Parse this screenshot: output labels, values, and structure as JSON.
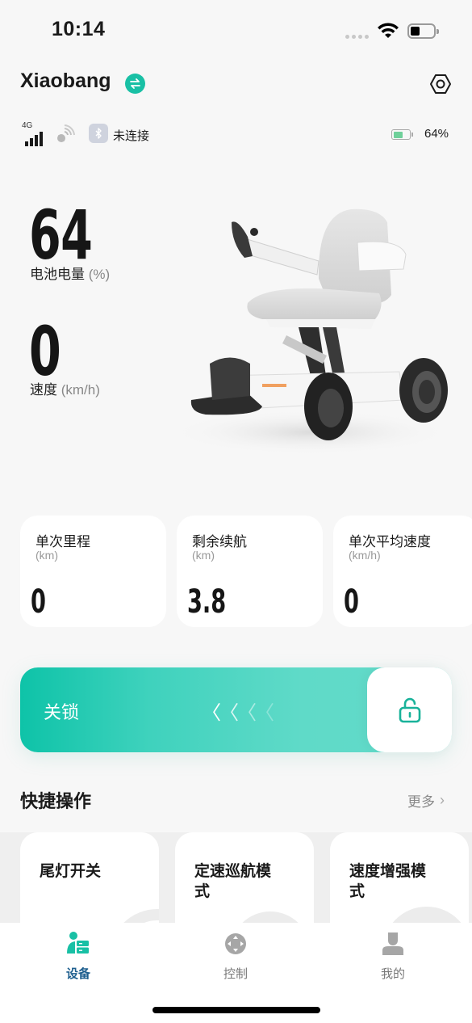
{
  "status_bar": {
    "time": "10:14",
    "icons": [
      "signal-dots-icon",
      "wifi-icon",
      "battery-icon"
    ]
  },
  "header": {
    "title": "Xiaobang",
    "switch_icon": "swap-arrows-icon",
    "settings_icon": "hex-settings-icon"
  },
  "connection": {
    "network_label": "4G",
    "network_icon": "cellular-signal-icon",
    "gps_icon": "satellite-icon",
    "bluetooth_icon": "bluetooth-icon",
    "bluetooth_status": "未连接",
    "battery_icon": "battery-icon",
    "battery_level": 0.64,
    "battery_percent": "64%"
  },
  "stats": {
    "battery_value": "64",
    "battery_label": "电池电量",
    "battery_unit": "(%)",
    "speed_value": "0",
    "speed_label": "速度",
    "speed_unit": "(km/h)"
  },
  "device_image": "wheelchair-illustration",
  "metrics": [
    {
      "title": "单次里程",
      "unit": "(km)",
      "value": "0"
    },
    {
      "title": "剩余续航",
      "unit": "(km)",
      "value": "3.8"
    },
    {
      "title": "单次平均速度",
      "unit": "(km/h)",
      "value": "0"
    }
  ],
  "lock_slider": {
    "label": "关锁",
    "chevrons": [
      "〈",
      "〈",
      "〈",
      "〈"
    ],
    "knob_icon": "unlock-icon",
    "accent": "#19c0a5"
  },
  "quick_actions": {
    "title": "快捷操作",
    "more_label": "更多",
    "items": [
      {
        "title": "尾灯开关"
      },
      {
        "title": "定速巡航模式"
      },
      {
        "title": "速度增强模式"
      }
    ]
  },
  "tabbar": {
    "tabs": [
      {
        "label": "设备",
        "icon": "device-icon",
        "active": true
      },
      {
        "label": "控制",
        "icon": "control-pad-icon",
        "active": false
      },
      {
        "label": "我的",
        "icon": "user-icon",
        "active": false
      }
    ],
    "active_color": "#1e5f8f",
    "accent": "#19c0a5"
  }
}
